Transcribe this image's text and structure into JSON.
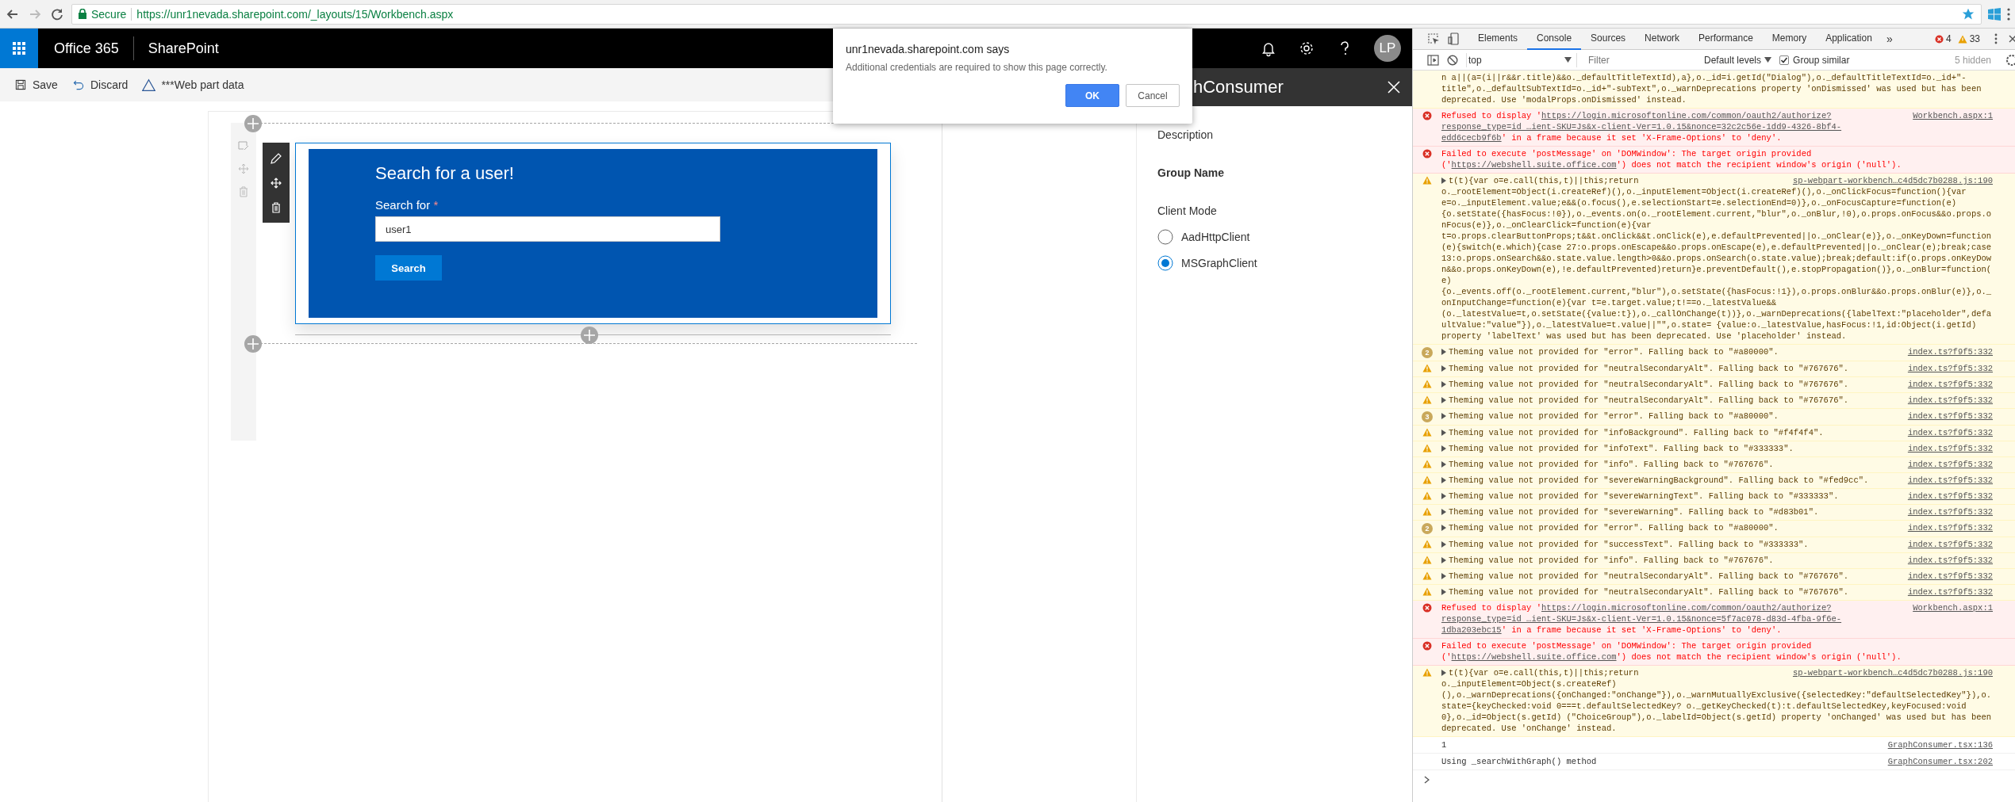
{
  "browser": {
    "secure_label": "Secure",
    "url": "https://unr1nevada.sharepoint.com/_layouts/15/Workbench.aspx"
  },
  "suite_bar": {
    "app": "Office 365",
    "site": "SharePoint",
    "avatar": "LP"
  },
  "toolbar": [
    {
      "kind": "save",
      "label": "Save"
    },
    {
      "kind": "discard",
      "label": "Discard"
    },
    {
      "kind": "warning",
      "label": "***Web part data"
    }
  ],
  "web_part": {
    "title": "Search for a user!",
    "field_label": "Search for",
    "required_mark": "*",
    "field_value": "user1",
    "button": "Search"
  },
  "property_pane": {
    "title": "hConsumer",
    "fields": [
      {
        "kind": "label",
        "text": "Description"
      },
      {
        "kind": "heading",
        "text": "Group Name"
      },
      {
        "kind": "label",
        "text": "Client Mode"
      }
    ],
    "options": [
      {
        "label": "AadHttpClient",
        "selected": false
      },
      {
        "label": "MSGraphClient",
        "selected": true
      }
    ]
  },
  "dialog": {
    "title": "unr1nevada.sharepoint.com says",
    "message": "Additional credentials are required to show this page correctly.",
    "buttons": [
      {
        "label": "OK",
        "primary": true
      },
      {
        "label": "Cancel",
        "primary": false
      }
    ]
  },
  "devtools": {
    "tabs": [
      {
        "label": "Elements",
        "selected": false
      },
      {
        "label": "Console",
        "selected": true
      },
      {
        "label": "Sources",
        "selected": false
      },
      {
        "label": "Network",
        "selected": false
      },
      {
        "label": "Performance",
        "selected": false
      },
      {
        "label": "Memory",
        "selected": false
      },
      {
        "label": "Application",
        "selected": false
      }
    ],
    "more": "»",
    "errors": "4",
    "warnings": "33",
    "context": "top",
    "filter_placeholder": "Filter",
    "levels": "Default levels",
    "group_similar": {
      "label": "Group similar",
      "checked": true
    },
    "hidden": "5 hidden",
    "messages": [
      {
        "kind": "warning",
        "expandable": false,
        "text": "n a||(a=(i||r&&r.title)&&o._defaultTitleTextId),a},o._id=i.getId(\"Dialog\"),o._defaultTitleTextId=o._id+\"-title\",o._defaultSubTextId=o._id+\"-subText\",o._warnDeprecations property 'onDismissed' was used but has been deprecated. Use 'modalProps.onDismissed' instead.",
        "continued": true
      },
      {
        "kind": "error",
        "expandable": false,
        "text": "Refused to display '",
        "link": "https://login.microsoftonline.com/common/oauth2/authorize?response_type=id …ient-SKU=Js&x-client-Ver=1.0.15&nonce=32c2c56e-1dd9-4326-8bf4-edd6cecb9f6b",
        "text_after": "' in a frame because it set 'X-Frame-Options' to 'deny'.",
        "source": "Workbench.aspx:1"
      },
      {
        "kind": "error",
        "expandable": false,
        "text": "Failed to execute 'postMessage' on 'DOMWindow': The target origin provided ('",
        "link": "https://webshell.suite.office.com",
        "text_after": "') does not match the recipient window's origin ('null')."
      },
      {
        "kind": "warning",
        "expandable": true,
        "text": "t(t){var o=e.call(this,t)||this;return",
        "more": "o._rootElement=Object(i.createRef)(),o._inputElement=Object(i.createRef)(),o._onClickFocus=function(){var e=o._inputElement.value;e&&(o.focus(),e.selectionStart=e.selectionEnd=0)},o._onFocusCapture=function(e){o.setState({hasFocus:!0}),o._events.on(o._rootElement.current,\"blur\",o._onBlur,!0),o.props.onFocus&&o.props.onFocus(e)},o._onClearClick=function(e){var t=o.props.clearButtonProps;t&&t.onClick&&t.onClick(e),e.defaultPrevented||o._onClear(e)},o._onKeyDown=function(e){switch(e.which){case 27:o.props.onEscape&&o.props.onEscape(e),e.defaultPrevented||o._onClear(e);break;case 13:o.props.onSearch&&o.state.value.length>0&&o.props.onSearch(o.state.value);break;default:if(o.props.onKeyDown&&o.props.onKeyDown(e),!e.defaultPrevented)return}e.preventDefault(),e.stopPropagation()},o._onBlur=function(e) {o._events.off(o._rootElement.current,\"blur\"),o.setState({hasFocus:!1}),o.props.onBlur&&o.props.onBlur(e)},o._onInputChange=function(e){var t=e.target.value;t!==o._latestValue&& (o._latestValue=t,o.setState({value:t}),o._callOnChange(t))},o._warnDeprecations({labelText:\"placeholder\",defaultValue:\"value\"}),o._latestValue=t.value||\"\",o.state= {value:o._latestValue,hasFocus:!1,id:Object(i.getId) property 'labelText' was used but has been deprecated. Use 'placeholder' instead.",
        "source": "sp-webpart-workbench…c4d5dc7b0288.js:190"
      },
      {
        "kind": "warning",
        "count": "2",
        "expandable": true,
        "text": "Theming value not provided for \"error\". Falling back to \"#a80000\".",
        "source": "index.ts?f9f5:332"
      },
      {
        "kind": "warning",
        "expandable": true,
        "text": "Theming value not provided for \"neutralSecondaryAlt\". Falling back to \"#767676\".",
        "source": "index.ts?f9f5:332"
      },
      {
        "kind": "warning",
        "expandable": true,
        "text": "Theming value not provided for \"neutralSecondaryAlt\". Falling back to \"#767676\".",
        "source": "index.ts?f9f5:332"
      },
      {
        "kind": "warning",
        "expandable": true,
        "text": "Theming value not provided for \"neutralSecondaryAlt\". Falling back to \"#767676\".",
        "source": "index.ts?f9f5:332"
      },
      {
        "kind": "warning",
        "count": "3",
        "expandable": true,
        "text": "Theming value not provided for \"error\". Falling back to \"#a80000\".",
        "source": "index.ts?f9f5:332"
      },
      {
        "kind": "warning",
        "expandable": true,
        "text": "Theming value not provided for \"infoBackground\". Falling back to \"#f4f4f4\".",
        "source": "index.ts?f9f5:332"
      },
      {
        "kind": "warning",
        "expandable": true,
        "text": "Theming value not provided for \"infoText\". Falling back to \"#333333\".",
        "source": "index.ts?f9f5:332"
      },
      {
        "kind": "warning",
        "expandable": true,
        "text": "Theming value not provided for \"info\". Falling back to \"#767676\".",
        "source": "index.ts?f9f5:332"
      },
      {
        "kind": "warning",
        "expandable": true,
        "text": "Theming value not provided for \"severeWarningBackground\". Falling back to \"#fed9cc\".",
        "source": "index.ts?f9f5:332"
      },
      {
        "kind": "warning",
        "expandable": true,
        "text": "Theming value not provided for \"severeWarningText\". Falling back to \"#333333\".",
        "source": "index.ts?f9f5:332"
      },
      {
        "kind": "warning",
        "expandable": true,
        "text": "Theming value not provided for \"severeWarning\". Falling back to \"#d83b01\".",
        "source": "index.ts?f9f5:332"
      },
      {
        "kind": "warning",
        "count": "2",
        "expandable": true,
        "text": "Theming value not provided for \"error\". Falling back to \"#a80000\".",
        "source": "index.ts?f9f5:332"
      },
      {
        "kind": "warning",
        "expandable": true,
        "text": "Theming value not provided for \"successText\". Falling back to \"#333333\".",
        "source": "index.ts?f9f5:332"
      },
      {
        "kind": "warning",
        "expandable": true,
        "text": "Theming value not provided for \"info\". Falling back to \"#767676\".",
        "source": "index.ts?f9f5:332"
      },
      {
        "kind": "warning",
        "expandable": true,
        "text": "Theming value not provided for \"neutralSecondaryAlt\". Falling back to \"#767676\".",
        "source": "index.ts?f9f5:332"
      },
      {
        "kind": "warning",
        "expandable": true,
        "text": "Theming value not provided for \"neutralSecondaryAlt\". Falling back to \"#767676\".",
        "source": "index.ts?f9f5:332"
      },
      {
        "kind": "error",
        "expandable": false,
        "text": "Refused to display '",
        "link": "https://login.microsoftonline.com/common/oauth2/authorize?response_type=id …ient-SKU=Js&x-client-Ver=1.0.15&nonce=5f7ac078-d83d-4fba-9f6e-1dba203ebc15",
        "text_after": "' in a frame because it set 'X-Frame-Options' to 'deny'.",
        "source": "Workbench.aspx:1"
      },
      {
        "kind": "error",
        "expandable": false,
        "text": "Failed to execute 'postMessage' on 'DOMWindow': The target origin provided ('",
        "link": "https://webshell.suite.office.com",
        "text_after": "') does not match the recipient window's origin ('null')."
      },
      {
        "kind": "warning",
        "expandable": true,
        "text": "t(t){var o=e.call(this,t)||this;return",
        "more": "o._inputElement=Object(s.createRef) (),o._warnDeprecations({onChanged:\"onChange\"}),o._warnMutuallyExclusive({selectedKey:\"defaultSelectedKey\"}),o.state={keyChecked:void 0===t.defaultSelectedKey? o._getKeyChecked(t):t.defaultSelectedKey,keyFocused:void 0},o._id=Object(s.getId) (\"ChoiceGroup\"),o._labelId=Object(s.getId) property 'onChanged' was used but has been deprecated. Use 'onChange' instead.",
        "source": "sp-webpart-workbench…c4d5dc7b0288.js:190"
      },
      {
        "kind": "log",
        "expandable": false,
        "text": "1",
        "source": "GraphConsumer.tsx:136"
      },
      {
        "kind": "log",
        "expandable": false,
        "text": "Using _searchWithGraph() method",
        "source": "GraphConsumer.tsx:202"
      }
    ]
  }
}
